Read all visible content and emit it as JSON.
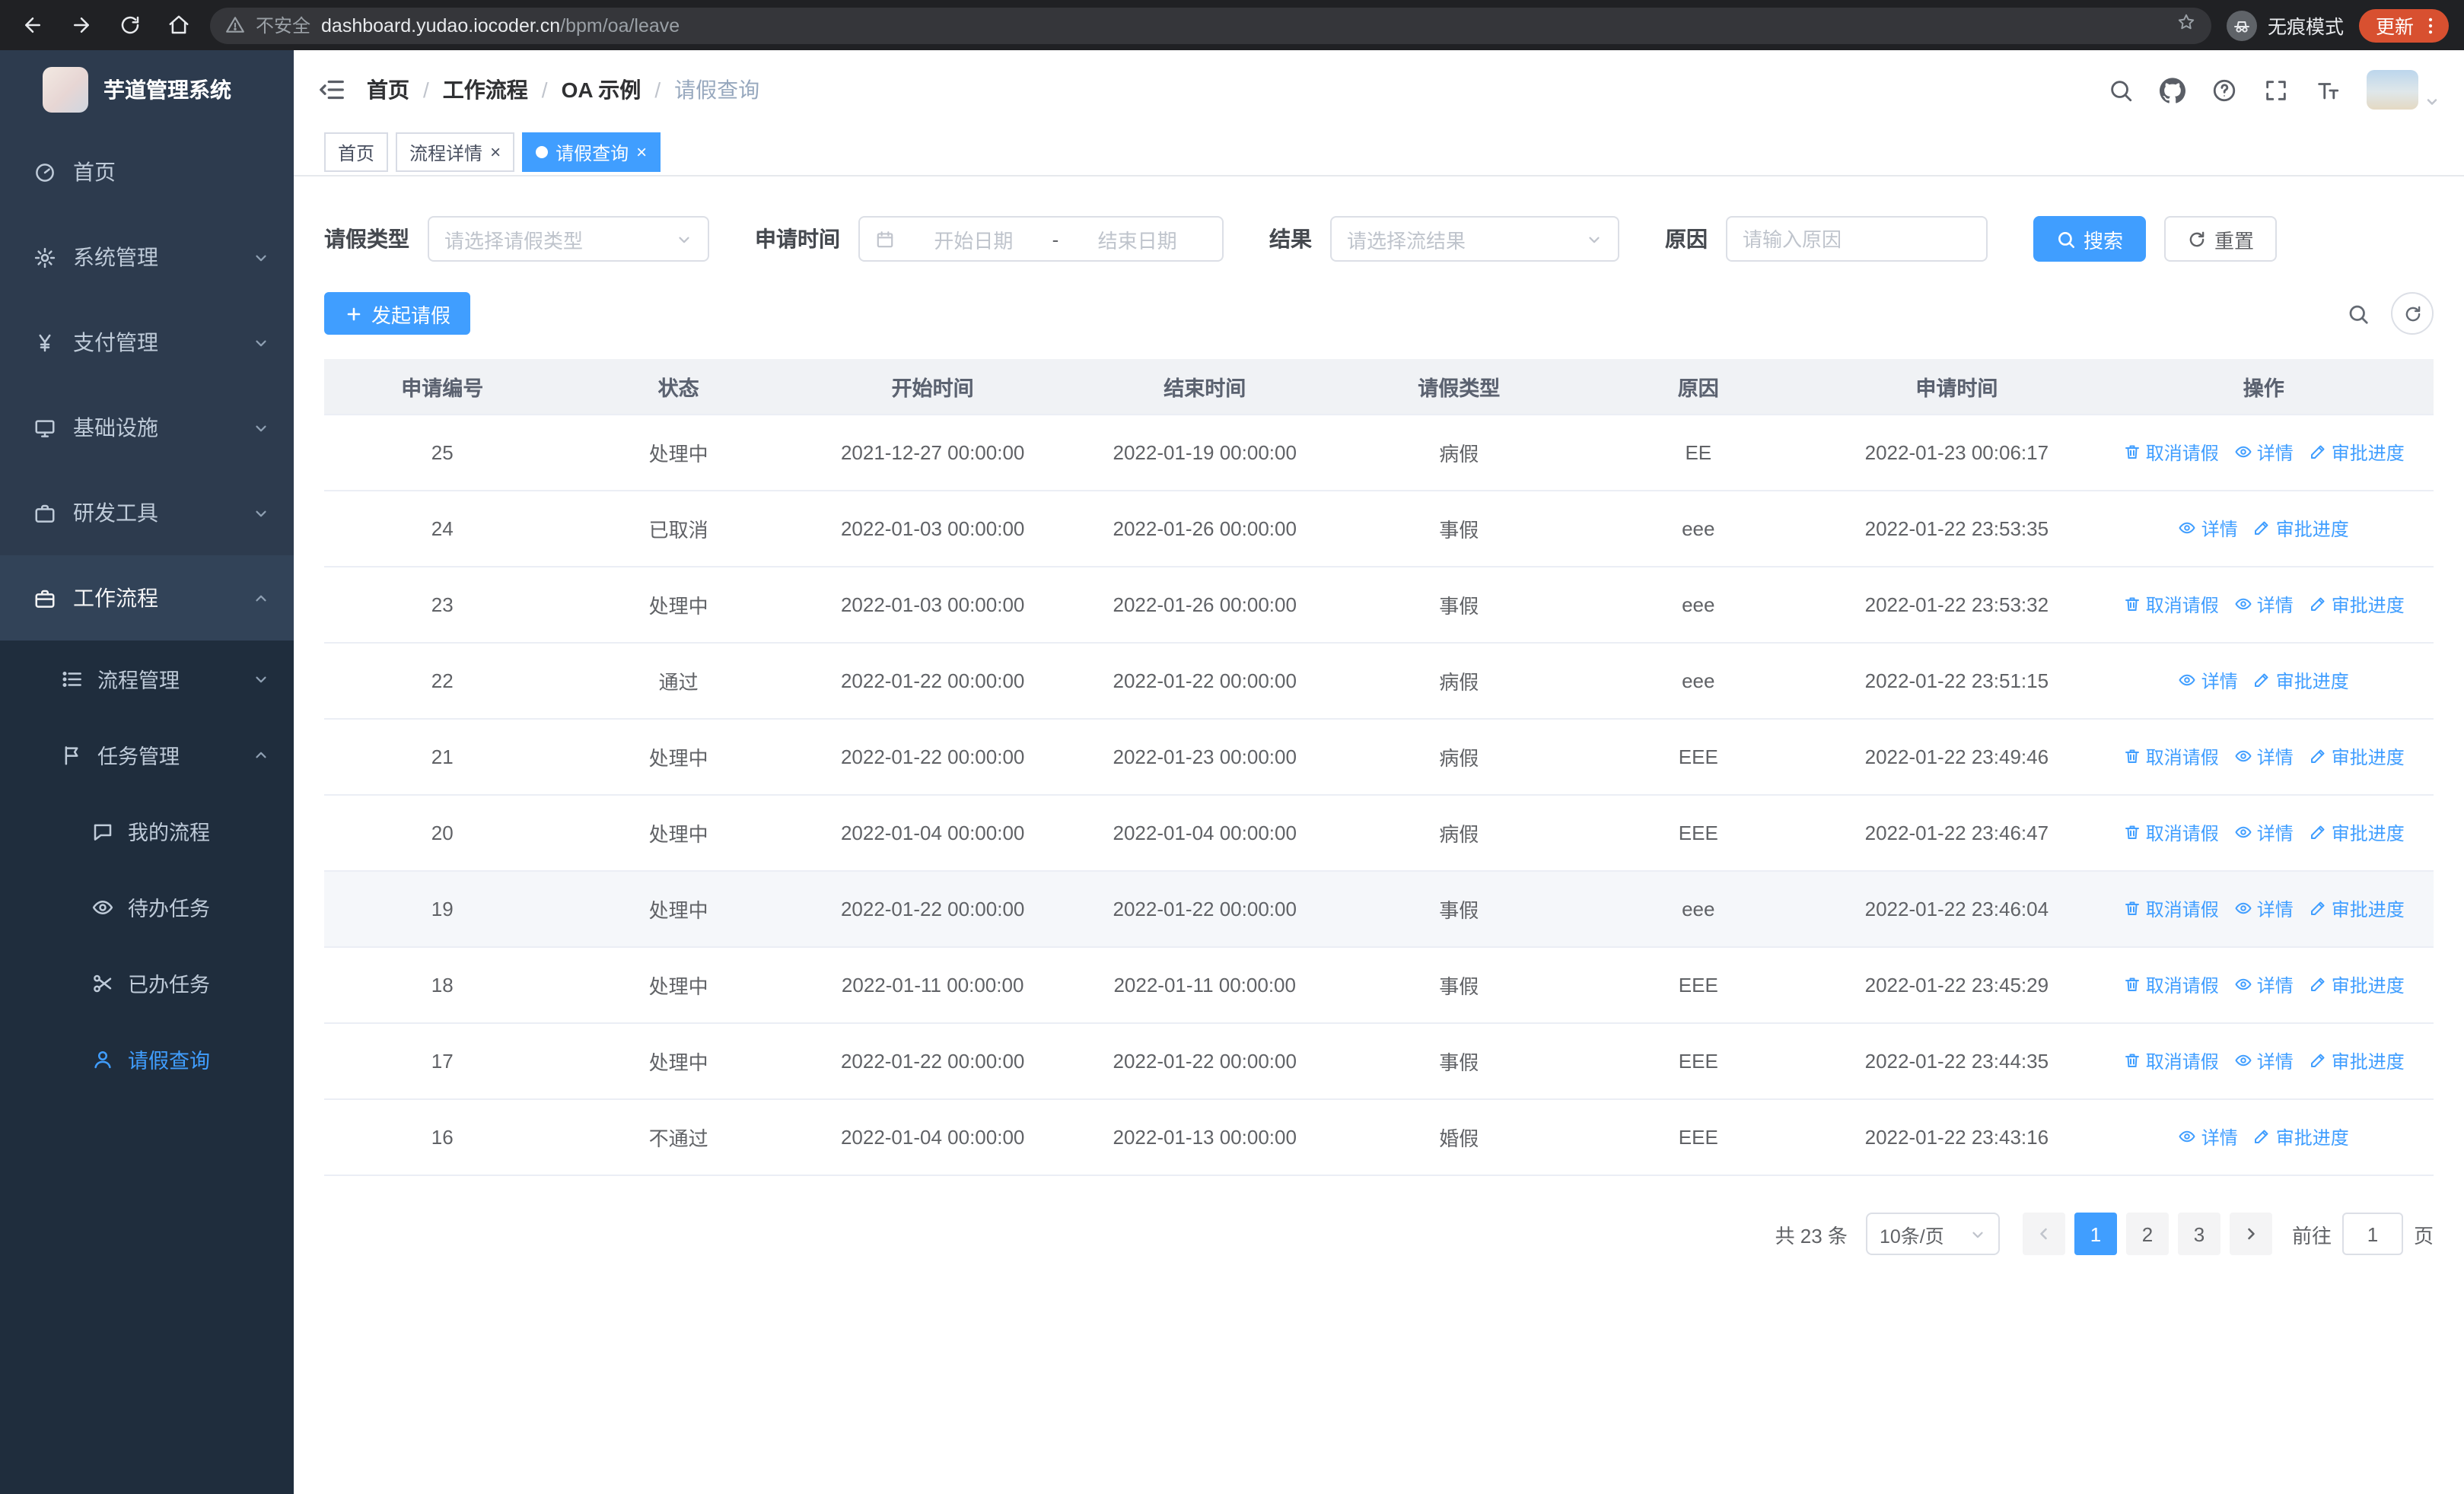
{
  "colors": {
    "accent": "#409eff",
    "chrome_bar": "#202124",
    "urlbar_bg": "#35363a",
    "sidebar_bg": "#1f2d3d",
    "sidebar_item_bg": "#2d3b4e",
    "sidebar_item_active_bg": "#324358",
    "sidebar_text": "#bfcbd9",
    "update_chip": "#d85030",
    "table_header_bg": "#f0f2f5",
    "row_highlight_bg": "#f5f7fa"
  },
  "browser": {
    "security_label": "不安全",
    "url_domain": "dashboard.yudao.iocoder.cn",
    "url_path": "/bpm/oa/leave",
    "incognito_label": "无痕模式",
    "update_label": "更新"
  },
  "sidebar": {
    "title": "芋道管理系统",
    "items": [
      {
        "label": "首页"
      },
      {
        "label": "系统管理"
      },
      {
        "label": "支付管理"
      },
      {
        "label": "基础设施"
      },
      {
        "label": "研发工具"
      },
      {
        "label": "工作流程",
        "children": [
          {
            "label": "流程管理"
          },
          {
            "label": "任务管理",
            "children": [
              {
                "label": "我的流程"
              },
              {
                "label": "待办任务"
              },
              {
                "label": "已办任务"
              },
              {
                "label": "请假查询"
              }
            ]
          }
        ]
      }
    ]
  },
  "navbar": {
    "breadcrumb": [
      "首页",
      "工作流程",
      "OA 示例",
      "请假查询"
    ]
  },
  "tags": [
    {
      "label": "首页"
    },
    {
      "label": "流程详情"
    },
    {
      "label": "请假查询"
    }
  ],
  "filters": {
    "leave_type_label": "请假类型",
    "leave_type_placeholder": "请选择请假类型",
    "apply_time_label": "申请时间",
    "start_placeholder": "开始日期",
    "range_separator": "-",
    "end_placeholder": "结束日期",
    "result_label": "结果",
    "result_placeholder": "请选择流结果",
    "reason_label": "原因",
    "reason_placeholder": "请输入原因",
    "search_label": "搜索",
    "reset_label": "重置"
  },
  "toolbar": {
    "create_label": "发起请假"
  },
  "table": {
    "columns": [
      "申请编号",
      "状态",
      "开始时间",
      "结束时间",
      "请假类型",
      "原因",
      "申请时间",
      "操作"
    ],
    "action_labels": {
      "cancel": "取消请假",
      "detail": "详情",
      "progress": "审批进度"
    },
    "rows": [
      {
        "id": "25",
        "status": "处理中",
        "start": "2021-12-27 00:00:00",
        "end": "2022-01-19 00:00:00",
        "type": "病假",
        "reason": "EE",
        "applied": "2022-01-23 00:06:17",
        "actions": [
          "cancel",
          "detail",
          "progress"
        ],
        "highlight": false
      },
      {
        "id": "24",
        "status": "已取消",
        "start": "2022-01-03 00:00:00",
        "end": "2022-01-26 00:00:00",
        "type": "事假",
        "reason": "eee",
        "applied": "2022-01-22 23:53:35",
        "actions": [
          "detail",
          "progress"
        ],
        "highlight": false
      },
      {
        "id": "23",
        "status": "处理中",
        "start": "2022-01-03 00:00:00",
        "end": "2022-01-26 00:00:00",
        "type": "事假",
        "reason": "eee",
        "applied": "2022-01-22 23:53:32",
        "actions": [
          "cancel",
          "detail",
          "progress"
        ],
        "highlight": false
      },
      {
        "id": "22",
        "status": "通过",
        "start": "2022-01-22 00:00:00",
        "end": "2022-01-22 00:00:00",
        "type": "病假",
        "reason": "eee",
        "applied": "2022-01-22 23:51:15",
        "actions": [
          "detail",
          "progress"
        ],
        "highlight": false
      },
      {
        "id": "21",
        "status": "处理中",
        "start": "2022-01-22 00:00:00",
        "end": "2022-01-23 00:00:00",
        "type": "病假",
        "reason": "EEE",
        "applied": "2022-01-22 23:49:46",
        "actions": [
          "cancel",
          "detail",
          "progress"
        ],
        "highlight": false
      },
      {
        "id": "20",
        "status": "处理中",
        "start": "2022-01-04 00:00:00",
        "end": "2022-01-04 00:00:00",
        "type": "病假",
        "reason": "EEE",
        "applied": "2022-01-22 23:46:47",
        "actions": [
          "cancel",
          "detail",
          "progress"
        ],
        "highlight": false
      },
      {
        "id": "19",
        "status": "处理中",
        "start": "2022-01-22 00:00:00",
        "end": "2022-01-22 00:00:00",
        "type": "事假",
        "reason": "eee",
        "applied": "2022-01-22 23:46:04",
        "actions": [
          "cancel",
          "detail",
          "progress"
        ],
        "highlight": true
      },
      {
        "id": "18",
        "status": "处理中",
        "start": "2022-01-11 00:00:00",
        "end": "2022-01-11 00:00:00",
        "type": "事假",
        "reason": "EEE",
        "applied": "2022-01-22 23:45:29",
        "actions": [
          "cancel",
          "detail",
          "progress"
        ],
        "highlight": false
      },
      {
        "id": "17",
        "status": "处理中",
        "start": "2022-01-22 00:00:00",
        "end": "2022-01-22 00:00:00",
        "type": "事假",
        "reason": "EEE",
        "applied": "2022-01-22 23:44:35",
        "actions": [
          "cancel",
          "detail",
          "progress"
        ],
        "highlight": false
      },
      {
        "id": "16",
        "status": "不通过",
        "start": "2022-01-04 00:00:00",
        "end": "2022-01-13 00:00:00",
        "type": "婚假",
        "reason": "EEE",
        "applied": "2022-01-22 23:43:16",
        "actions": [
          "detail",
          "progress"
        ],
        "highlight": false
      }
    ]
  },
  "pagination": {
    "total": "共 23 条",
    "page_size": "10条/页",
    "pages": [
      "1",
      "2",
      "3"
    ],
    "active_page": "1",
    "goto_label": "前往",
    "goto_value": "1",
    "goto_unit": "页"
  },
  "icons": [
    "back-arrow-icon",
    "forward-arrow-icon",
    "reload-icon",
    "home-icon",
    "warning-icon",
    "star-icon",
    "incognito-icon",
    "more-menu-icon",
    "hamburger-fold-icon",
    "search-icon",
    "github-icon",
    "question-icon",
    "fullscreen-icon",
    "font-size-icon",
    "caret-down-icon",
    "dashboard-icon",
    "gear-icon",
    "yen-icon",
    "monitor-icon",
    "briefcase-icon",
    "list-icon",
    "flag-icon",
    "chat-icon",
    "eye-icon",
    "scissors-icon",
    "user-icon",
    "chevron-down-icon",
    "chevron-up-icon",
    "calendar-icon",
    "plus-icon",
    "refresh-icon",
    "trash-icon",
    "edit-icon",
    "chevron-left-icon",
    "chevron-right-icon"
  ]
}
